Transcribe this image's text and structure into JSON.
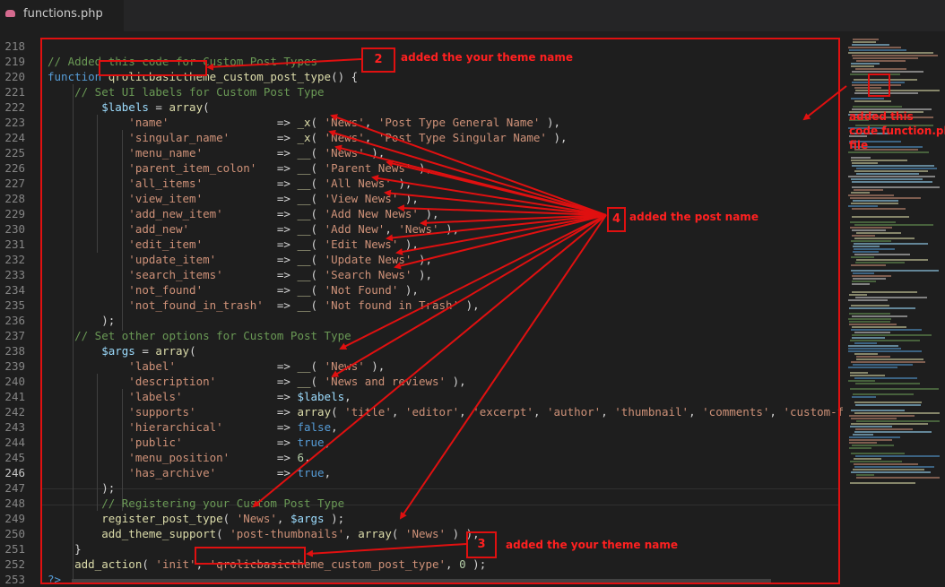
{
  "tab": {
    "filename": "functions.php",
    "icon": "php-elephant-icon"
  },
  "colors": {
    "annotation": "#e01010",
    "comment": "#6a9955",
    "keyword": "#569cd6",
    "string": "#ce9178",
    "function": "#dcdcaa",
    "variable": "#9cdcfe",
    "number": "#b5cea8"
  },
  "active_line": "246",
  "lines": [
    {
      "n": "218",
      "tokens": []
    },
    {
      "n": "219",
      "tokens": [
        [
          "c",
          "// Added this code for Custom Post Types"
        ]
      ]
    },
    {
      "n": "220",
      "tokens": [
        [
          "k",
          "function "
        ],
        [
          "f",
          "qrolicbasictheme_custom_post_type"
        ],
        [
          "p",
          "() {"
        ]
      ]
    },
    {
      "n": "221",
      "tokens": [
        [
          "c",
          "    // Set UI labels for Custom Post Type"
        ]
      ]
    },
    {
      "n": "222",
      "tokens": [
        [
          "v",
          "        $labels"
        ],
        [
          "p",
          " = "
        ],
        [
          "f",
          "array"
        ],
        [
          "p",
          "("
        ]
      ]
    },
    {
      "n": "223",
      "tokens": [
        [
          "s",
          "            'name'"
        ],
        [
          "p",
          "                => "
        ],
        [
          "f",
          "_x"
        ],
        [
          "p",
          "( "
        ],
        [
          "s",
          "'News'"
        ],
        [
          "p",
          ", "
        ],
        [
          "s",
          "'Post Type General Name'"
        ],
        [
          "p",
          " ),"
        ]
      ]
    },
    {
      "n": "224",
      "tokens": [
        [
          "s",
          "            'singular_name'"
        ],
        [
          "p",
          "       => "
        ],
        [
          "f",
          "_x"
        ],
        [
          "p",
          "( "
        ],
        [
          "s",
          "'News'"
        ],
        [
          "p",
          ", "
        ],
        [
          "s",
          "'Post Type Singular Name'"
        ],
        [
          "p",
          " ),"
        ]
      ]
    },
    {
      "n": "225",
      "tokens": [
        [
          "s",
          "            'menu_name'"
        ],
        [
          "p",
          "           => "
        ],
        [
          "f",
          "__"
        ],
        [
          "p",
          "( "
        ],
        [
          "s",
          "'News'"
        ],
        [
          "p",
          " ),"
        ]
      ]
    },
    {
      "n": "226",
      "tokens": [
        [
          "s",
          "            'parent_item_colon'"
        ],
        [
          "p",
          "   => "
        ],
        [
          "f",
          "__"
        ],
        [
          "p",
          "( "
        ],
        [
          "s",
          "'Parent News'"
        ],
        [
          "p",
          " ),"
        ]
      ]
    },
    {
      "n": "227",
      "tokens": [
        [
          "s",
          "            'all_items'"
        ],
        [
          "p",
          "           => "
        ],
        [
          "f",
          "__"
        ],
        [
          "p",
          "( "
        ],
        [
          "s",
          "'All News'"
        ],
        [
          "p",
          " ),"
        ]
      ]
    },
    {
      "n": "228",
      "tokens": [
        [
          "s",
          "            'view_item'"
        ],
        [
          "p",
          "           => "
        ],
        [
          "f",
          "__"
        ],
        [
          "p",
          "( "
        ],
        [
          "s",
          "'View News'"
        ],
        [
          "p",
          " ),"
        ]
      ]
    },
    {
      "n": "229",
      "tokens": [
        [
          "s",
          "            'add_new_item'"
        ],
        [
          "p",
          "        => "
        ],
        [
          "f",
          "__"
        ],
        [
          "p",
          "( "
        ],
        [
          "s",
          "'Add New News'"
        ],
        [
          "p",
          " ),"
        ]
      ]
    },
    {
      "n": "230",
      "tokens": [
        [
          "s",
          "            'add_new'"
        ],
        [
          "p",
          "             => "
        ],
        [
          "f",
          "__"
        ],
        [
          "p",
          "( "
        ],
        [
          "s",
          "'Add New'"
        ],
        [
          "p",
          ", "
        ],
        [
          "s",
          "'News'"
        ],
        [
          "p",
          " ),"
        ]
      ]
    },
    {
      "n": "231",
      "tokens": [
        [
          "s",
          "            'edit_item'"
        ],
        [
          "p",
          "           => "
        ],
        [
          "f",
          "__"
        ],
        [
          "p",
          "( "
        ],
        [
          "s",
          "'Edit News'"
        ],
        [
          "p",
          " ),"
        ]
      ]
    },
    {
      "n": "232",
      "tokens": [
        [
          "s",
          "            'update_item'"
        ],
        [
          "p",
          "         => "
        ],
        [
          "f",
          "__"
        ],
        [
          "p",
          "( "
        ],
        [
          "s",
          "'Update News'"
        ],
        [
          "p",
          " ),"
        ]
      ]
    },
    {
      "n": "233",
      "tokens": [
        [
          "s",
          "            'search_items'"
        ],
        [
          "p",
          "        => "
        ],
        [
          "f",
          "__"
        ],
        [
          "p",
          "( "
        ],
        [
          "s",
          "'Search News'"
        ],
        [
          "p",
          " ),"
        ]
      ]
    },
    {
      "n": "234",
      "tokens": [
        [
          "s",
          "            'not_found'"
        ],
        [
          "p",
          "           => "
        ],
        [
          "f",
          "__"
        ],
        [
          "p",
          "( "
        ],
        [
          "s",
          "'Not Found'"
        ],
        [
          "p",
          " ),"
        ]
      ]
    },
    {
      "n": "235",
      "tokens": [
        [
          "s",
          "            'not_found_in_trash'"
        ],
        [
          "p",
          "  => "
        ],
        [
          "f",
          "__"
        ],
        [
          "p",
          "( "
        ],
        [
          "s",
          "'Not found in Trash'"
        ],
        [
          "p",
          " ),"
        ]
      ]
    },
    {
      "n": "236",
      "tokens": [
        [
          "p",
          "        );"
        ]
      ]
    },
    {
      "n": "237",
      "tokens": [
        [
          "c",
          "    // Set other options for Custom Post Type"
        ]
      ]
    },
    {
      "n": "238",
      "tokens": [
        [
          "v",
          "        $args"
        ],
        [
          "p",
          " = "
        ],
        [
          "f",
          "array"
        ],
        [
          "p",
          "("
        ]
      ]
    },
    {
      "n": "239",
      "tokens": [
        [
          "s",
          "            'label'"
        ],
        [
          "p",
          "               => "
        ],
        [
          "f",
          "__"
        ],
        [
          "p",
          "( "
        ],
        [
          "s",
          "'News'"
        ],
        [
          "p",
          " ),"
        ]
      ]
    },
    {
      "n": "240",
      "tokens": [
        [
          "s",
          "            'description'"
        ],
        [
          "p",
          "         => "
        ],
        [
          "f",
          "__"
        ],
        [
          "p",
          "( "
        ],
        [
          "s",
          "'News and reviews'"
        ],
        [
          "p",
          " ),"
        ]
      ]
    },
    {
      "n": "241",
      "tokens": [
        [
          "s",
          "            'labels'"
        ],
        [
          "p",
          "              => "
        ],
        [
          "v",
          "$labels"
        ],
        [
          "p",
          ","
        ]
      ]
    },
    {
      "n": "242",
      "tokens": [
        [
          "s",
          "            'supports'"
        ],
        [
          "p",
          "            => "
        ],
        [
          "f",
          "array"
        ],
        [
          "p",
          "( "
        ],
        [
          "s",
          "'title'"
        ],
        [
          "p",
          ", "
        ],
        [
          "s",
          "'editor'"
        ],
        [
          "p",
          ", "
        ],
        [
          "s",
          "'excerpt'"
        ],
        [
          "p",
          ", "
        ],
        [
          "s",
          "'author'"
        ],
        [
          "p",
          ", "
        ],
        [
          "s",
          "'thumbnail'"
        ],
        [
          "p",
          ", "
        ],
        [
          "s",
          "'comments'"
        ],
        [
          "p",
          ", "
        ],
        [
          "s",
          "'custom-fields'"
        ],
        [
          "p",
          ", )"
        ]
      ]
    },
    {
      "n": "243",
      "tokens": [
        [
          "s",
          "            'hierarchical'"
        ],
        [
          "p",
          "        => "
        ],
        [
          "t",
          "false"
        ],
        [
          "p",
          ","
        ]
      ]
    },
    {
      "n": "244",
      "tokens": [
        [
          "s",
          "            'public'"
        ],
        [
          "p",
          "              => "
        ],
        [
          "t",
          "true"
        ],
        [
          "p",
          ","
        ]
      ]
    },
    {
      "n": "245",
      "tokens": [
        [
          "s",
          "            'menu_position'"
        ],
        [
          "p",
          "       => "
        ],
        [
          "n",
          "6"
        ],
        [
          "p",
          ","
        ]
      ]
    },
    {
      "n": "246",
      "tokens": [
        [
          "s",
          "            'has_archive'"
        ],
        [
          "p",
          "         => "
        ],
        [
          "t",
          "true"
        ],
        [
          "p",
          ","
        ]
      ]
    },
    {
      "n": "247",
      "tokens": [
        [
          "p",
          "        );"
        ]
      ]
    },
    {
      "n": "248",
      "tokens": [
        [
          "c",
          "        // Registering your Custom Post Type"
        ]
      ]
    },
    {
      "n": "249",
      "tokens": [
        [
          "f",
          "        register_post_type"
        ],
        [
          "p",
          "( "
        ],
        [
          "s",
          "'News'"
        ],
        [
          "p",
          ", "
        ],
        [
          "v",
          "$args"
        ],
        [
          "p",
          " );"
        ]
      ]
    },
    {
      "n": "250",
      "tokens": [
        [
          "f",
          "        add_theme_support"
        ],
        [
          "p",
          "( "
        ],
        [
          "s",
          "'post-thumbnails'"
        ],
        [
          "p",
          ", "
        ],
        [
          "f",
          "array"
        ],
        [
          "p",
          "( "
        ],
        [
          "s",
          "'News'"
        ],
        [
          "p",
          " ) );"
        ]
      ]
    },
    {
      "n": "251",
      "tokens": [
        [
          "p",
          "    }"
        ]
      ]
    },
    {
      "n": "252",
      "tokens": [
        [
          "f",
          "    add_action"
        ],
        [
          "p",
          "( "
        ],
        [
          "s",
          "'init'"
        ],
        [
          "p",
          ", "
        ],
        [
          "s",
          "'qrolicbasictheme_custom_post_type'"
        ],
        [
          "p",
          ", "
        ],
        [
          "n",
          "0"
        ],
        [
          "p",
          " );"
        ]
      ]
    },
    {
      "n": "253",
      "tokens": [
        [
          "k",
          "?>"
        ]
      ]
    }
  ],
  "annotations": {
    "a2": {
      "num": "2",
      "text": "added the your theme name"
    },
    "a3": {
      "num": "3",
      "text": "added the your theme name"
    },
    "a4": {
      "num": "4",
      "text": "added the post name"
    },
    "a1": {
      "text_l1": "added this",
      "text_l2": "code function.ph",
      "text_l3": "file"
    }
  }
}
